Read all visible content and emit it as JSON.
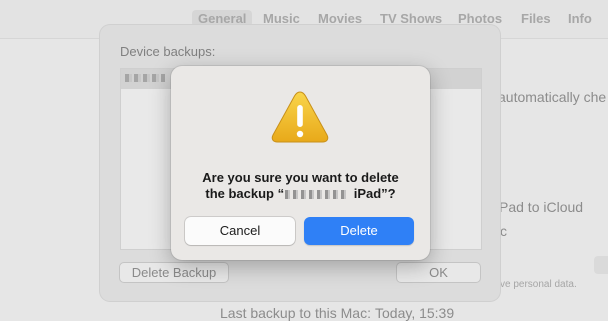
{
  "tabs": [
    "General",
    "Music",
    "Movies",
    "TV Shows",
    "Photos",
    "Files",
    "Info"
  ],
  "background": {
    "auto_check_text": "automatically che",
    "icloud_text": "Pad to iCloud",
    "c_text": "c",
    "personal_data_text": "ve personal data.",
    "last_backup_label": "Last backup to this Mac:",
    "last_backup_value": "Today, 15:39"
  },
  "backups_sheet": {
    "label": "Device backups:",
    "delete_backup_button": "Delete Backup",
    "ok_button": "OK"
  },
  "alert": {
    "icon": "warning-triangle-icon",
    "message_line1": "Are you sure you want to delete",
    "message_line2_prefix": "the backup “",
    "message_line2_suffix": " iPad”?",
    "cancel_button": "Cancel",
    "delete_button": "Delete",
    "accent_color": "#2f80f6"
  }
}
